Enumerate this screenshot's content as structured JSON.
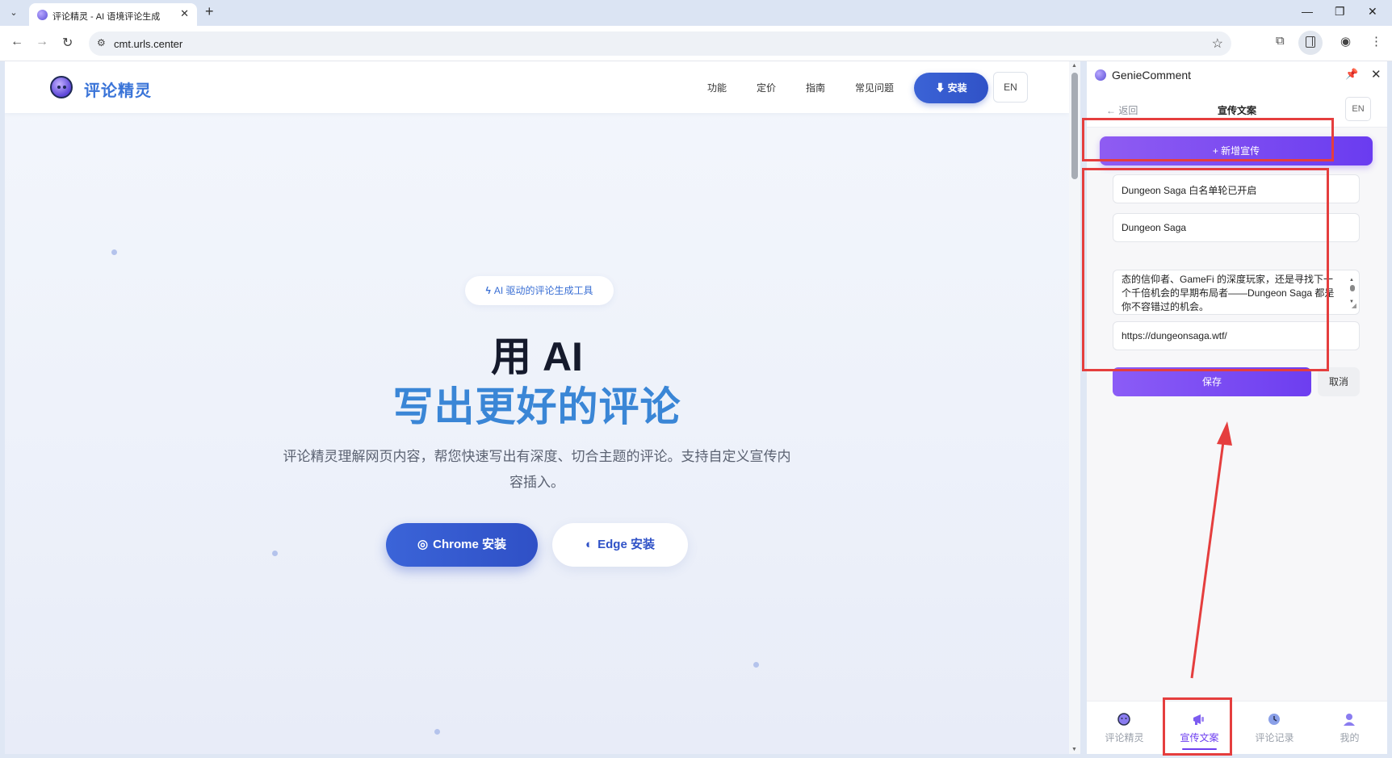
{
  "browser": {
    "tab_title": "评论精灵 - AI 语境评论生成",
    "url": "cmt.urls.center"
  },
  "site": {
    "logo_text": "评论精灵",
    "nav": [
      "功能",
      "定价",
      "指南",
      "常见问题"
    ],
    "install_label": "安装",
    "lang_label": "EN",
    "badge": "AI 驱动的评论生成工具",
    "hero_title_1": "用 AI",
    "hero_title_2": "写出更好的评论",
    "hero_desc": "评论精灵理解网页内容，帮您快速写出有深度、切合主题的评论。支持自定义宣传内容插入。",
    "chrome_btn": "Chrome 安装",
    "edge_btn": "Edge 安装"
  },
  "panel": {
    "name": "GenieComment",
    "back": "← 返回",
    "title": "宣传文案",
    "lang": "EN",
    "add_button": "+ 新增宣传",
    "form": {
      "title_value": "Dungeon Saga 白名单轮已开启",
      "name_value": "Dungeon Saga",
      "content_value": "态的信仰者、GameFi 的深度玩家，还是寻找下一个千倍机会的早期布局者——Dungeon Saga 都是你不容错过的机会。",
      "url_value": "https://dungeonsaga.wtf/",
      "save": "保存",
      "cancel": "取消"
    },
    "bottom_nav": [
      {
        "label": "评论精灵",
        "icon": "genie-icon"
      },
      {
        "label": "宣传文案",
        "icon": "megaphone-icon"
      },
      {
        "label": "评论记录",
        "icon": "history-icon"
      },
      {
        "label": "我的",
        "icon": "user-icon"
      }
    ],
    "active_tab": "宣传文案"
  },
  "colors": {
    "accent_purple": "#6d3ef0",
    "brand_blue": "#3052c7",
    "highlight_red": "#e53e3e"
  }
}
